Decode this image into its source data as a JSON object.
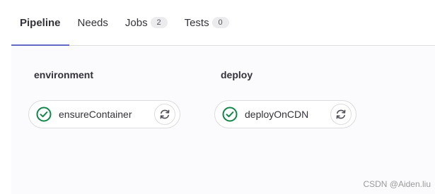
{
  "tabs": [
    {
      "label": "Pipeline",
      "active": true
    },
    {
      "label": "Needs"
    },
    {
      "label": "Jobs",
      "count": "2"
    },
    {
      "label": "Tests",
      "count": "0"
    }
  ],
  "stages": [
    {
      "title": "environment",
      "job": {
        "name": "ensureContainer",
        "status": "success",
        "status_icon": "check-circle-icon",
        "action_icon": "retry-icon"
      }
    },
    {
      "title": "deploy",
      "job": {
        "name": "deployOnCDN",
        "status": "success",
        "status_icon": "check-circle-icon",
        "action_icon": "retry-icon"
      }
    }
  ],
  "colors": {
    "accent": "#6666c4",
    "success": "#108548",
    "panel_bg": "#fbfafd"
  },
  "watermark": "CSDN @Aiden.liu"
}
